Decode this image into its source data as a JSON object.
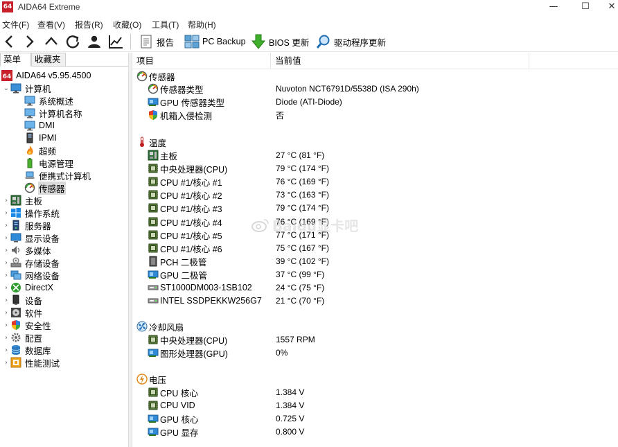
{
  "window": {
    "logo_text": "64",
    "title": "AIDA64 Extreme",
    "min_glyph": "—",
    "max_glyph": "☐",
    "close_glyph": "✕"
  },
  "menu": [
    "文件(F)",
    "查看(V)",
    "报告(R)",
    "收藏(O)",
    "工具(T)",
    "帮助(H)"
  ],
  "toolbar": {
    "nav_icons": [
      "back-arrow-icon",
      "forward-arrow-icon",
      "up-arrow-icon",
      "refresh-icon",
      "user-icon",
      "chart-icon"
    ],
    "buttons": [
      {
        "label": "报告",
        "icon": "report-icon"
      },
      {
        "label": "PC Backup",
        "icon": "pc-backup-icon"
      },
      {
        "label": "BIOS 更新",
        "icon": "bios-update-icon"
      },
      {
        "label": "驱动程序更新",
        "icon": "driver-update-icon"
      }
    ]
  },
  "left_panel": {
    "tabs": [
      "菜单",
      "收藏夹"
    ],
    "tree": [
      {
        "label": "AIDA64 v5.95.4500",
        "level": 0,
        "expander": "",
        "icon": "aida64-logo-icon"
      },
      {
        "label": "计算机",
        "level": 0,
        "expander": "v",
        "icon": "computer-icon"
      },
      {
        "label": "系统概述",
        "level": 1,
        "expander": "",
        "icon": "monitor-icon"
      },
      {
        "label": "计算机名称",
        "level": 1,
        "expander": "",
        "icon": "monitor-icon"
      },
      {
        "label": "DMI",
        "level": 1,
        "expander": "",
        "icon": "monitor-icon"
      },
      {
        "label": "IPMI",
        "level": 1,
        "expander": "",
        "icon": "server-tower-icon"
      },
      {
        "label": "超频",
        "level": 1,
        "expander": "",
        "icon": "flame-icon"
      },
      {
        "label": "电源管理",
        "level": 1,
        "expander": "",
        "icon": "battery-icon"
      },
      {
        "label": "便携式计算机",
        "level": 1,
        "expander": "",
        "icon": "laptop-icon"
      },
      {
        "label": "传感器",
        "level": 1,
        "expander": "",
        "icon": "sensor-gauge-icon",
        "selected": true
      },
      {
        "label": "主板",
        "level": 0,
        "expander": ">",
        "icon": "motherboard-icon"
      },
      {
        "label": "操作系统",
        "level": 0,
        "expander": ">",
        "icon": "windows-icon"
      },
      {
        "label": "服务器",
        "level": 0,
        "expander": ">",
        "icon": "server-icon"
      },
      {
        "label": "显示设备",
        "level": 0,
        "expander": ">",
        "icon": "display-icon"
      },
      {
        "label": "多媒体",
        "level": 0,
        "expander": ">",
        "icon": "speaker-icon"
      },
      {
        "label": "存储设备",
        "level": 0,
        "expander": ">",
        "icon": "storage-icon"
      },
      {
        "label": "网络设备",
        "level": 0,
        "expander": ">",
        "icon": "network-icon"
      },
      {
        "label": "DirectX",
        "level": 0,
        "expander": ">",
        "icon": "xbox-icon"
      },
      {
        "label": "设备",
        "level": 0,
        "expander": ">",
        "icon": "device-icon"
      },
      {
        "label": "软件",
        "level": 0,
        "expander": ">",
        "icon": "software-disc-icon"
      },
      {
        "label": "安全性",
        "level": 0,
        "expander": ">",
        "icon": "shield-icon"
      },
      {
        "label": "配置",
        "level": 0,
        "expander": ">",
        "icon": "config-gear-icon"
      },
      {
        "label": "数据库",
        "level": 0,
        "expander": ">",
        "icon": "database-icon"
      },
      {
        "label": "性能测试",
        "level": 0,
        "expander": ">",
        "icon": "benchmark-icon"
      }
    ]
  },
  "right_panel": {
    "columns": [
      "项目",
      "当前值"
    ],
    "sections": [
      {
        "title": "传感器",
        "icon": "sensor-gauge-icon",
        "rows": [
          {
            "label": "传感器类型",
            "value": "Nuvoton NCT6791D/5538D  (ISA 290h)",
            "icon": "sensor-gauge-icon"
          },
          {
            "label": "GPU 传感器类型",
            "value": "Diode  (ATI-Diode)",
            "icon": "gpu-icon"
          },
          {
            "label": "机箱入侵检测",
            "value": "否",
            "icon": "shield-icon"
          }
        ]
      },
      {
        "title": "温度",
        "icon": "thermometer-icon",
        "rows": [
          {
            "label": "主板",
            "value": "27 °C  (81 °F)",
            "icon": "motherboard-icon"
          },
          {
            "label": "中央处理器(CPU)",
            "value": "79 °C  (174 °F)",
            "icon": "cpu-chip-icon"
          },
          {
            "label": "CPU #1/核心 #1",
            "value": "76 °C  (169 °F)",
            "icon": "cpu-chip-icon"
          },
          {
            "label": "CPU #1/核心 #2",
            "value": "73 °C  (163 °F)",
            "icon": "cpu-chip-icon"
          },
          {
            "label": "CPU #1/核心 #3",
            "value": "79 °C  (174 °F)",
            "icon": "cpu-chip-icon"
          },
          {
            "label": "CPU #1/核心 #4",
            "value": "76 °C  (169 °F)",
            "icon": "cpu-chip-icon"
          },
          {
            "label": "CPU #1/核心 #5",
            "value": "77 °C  (171 °F)",
            "icon": "cpu-chip-icon"
          },
          {
            "label": "CPU #1/核心 #6",
            "value": "75 °C  (167 °F)",
            "icon": "cpu-chip-icon"
          },
          {
            "label": "PCH 二极管",
            "value": "39 °C  (102 °F)",
            "icon": "pch-chip-icon"
          },
          {
            "label": "GPU 二极管",
            "value": "37 °C  (99 °F)",
            "icon": "gpu-icon"
          },
          {
            "label": "ST1000DM003-1SB102",
            "value": "24 °C  (75 °F)",
            "icon": "hdd-icon"
          },
          {
            "label": "INTEL SSDPEKKW256G7",
            "value": "21 °C  (70 °F)",
            "icon": "hdd-icon"
          }
        ]
      },
      {
        "title": "冷却风扇",
        "icon": "fan-icon",
        "rows": [
          {
            "label": "中央处理器(CPU)",
            "value": "1557 RPM",
            "icon": "cpu-chip-icon"
          },
          {
            "label": "图形处理器(GPU)",
            "value": "0%",
            "icon": "gpu-icon"
          }
        ]
      },
      {
        "title": "电压",
        "icon": "voltage-icon",
        "rows": [
          {
            "label": "CPU 核心",
            "value": "1.384 V",
            "icon": "cpu-chip-icon"
          },
          {
            "label": "CPU VID",
            "value": "1.384 V",
            "icon": "cpu-chip-icon"
          },
          {
            "label": "GPU 核心",
            "value": "0.725 V",
            "icon": "gpu-icon"
          },
          {
            "label": "GPU 显存",
            "value": "0.800 V",
            "icon": "gpu-icon"
          }
        ]
      }
    ]
  },
  "watermark": "Baidu显卡吧"
}
